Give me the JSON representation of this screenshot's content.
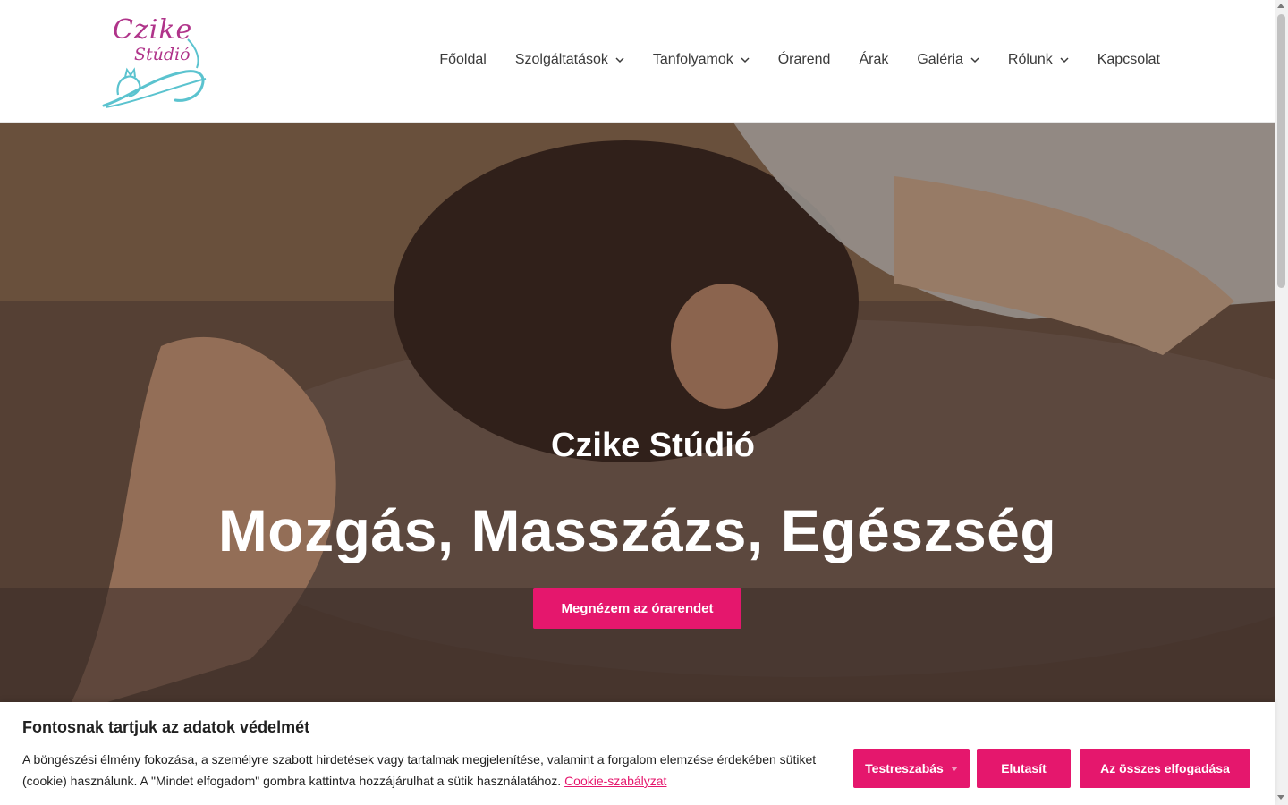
{
  "header": {
    "logo": {
      "text_line1": "Czike",
      "text_line2": "Stúdió"
    },
    "nav": [
      {
        "label": "Főoldal",
        "has_dropdown": false
      },
      {
        "label": "Szolgáltatások",
        "has_dropdown": true
      },
      {
        "label": "Tanfolyamok",
        "has_dropdown": true
      },
      {
        "label": "Órarend",
        "has_dropdown": false
      },
      {
        "label": "Árak",
        "has_dropdown": false
      },
      {
        "label": "Galéria",
        "has_dropdown": true
      },
      {
        "label": "Rólunk",
        "has_dropdown": true
      },
      {
        "label": "Kapcsolat",
        "has_dropdown": false
      }
    ]
  },
  "hero": {
    "subtitle": "Czike Stúdió",
    "title": "Mozgás, Masszázs, Egészség",
    "cta_label": "Megnézem az órarendet"
  },
  "cookie": {
    "title": "Fontosnak tartjuk az adatok védelmét",
    "text": "A böngészési élmény fokozása, a személyre szabott hirdetések vagy tartalmak megjelenítése, valamint a forgalom elemzése érdekében sütiket (cookie) használunk. A \"Mindet elfogadom\" gombra kattintva hozzájárulhat a sütik használatához.",
    "link_label": "Cookie-szabályzat",
    "customize_label": "Testreszabás",
    "reject_label": "Elutasít",
    "accept_label": "Az összes elfogadása"
  },
  "colors": {
    "accent": "#e5176d",
    "logo_pink": "#b0348a",
    "logo_teal": "#5bc3cf",
    "nav_text": "#3a3a3a"
  }
}
